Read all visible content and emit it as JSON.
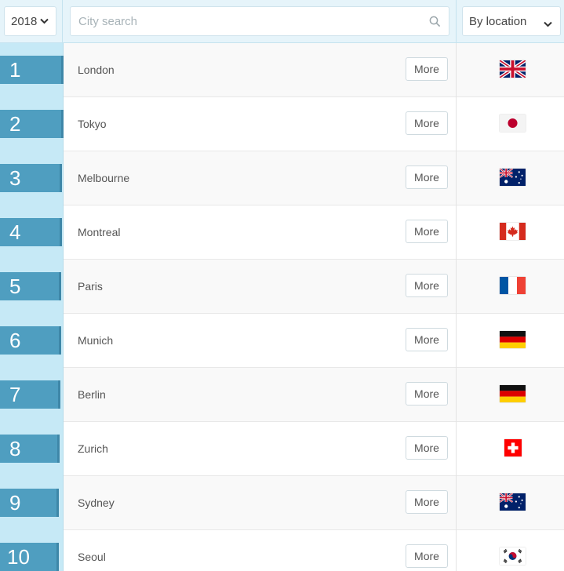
{
  "filters": {
    "year_value": "2018",
    "search_placeholder": "City search",
    "sort_value": "By location"
  },
  "colors": {
    "rank_bar": "#4f9ec0",
    "rank_cell": "#c6e9f6",
    "header_bg": "#e6f4fa"
  },
  "rows": [
    {
      "rank": "1",
      "city": "London",
      "more": "More",
      "flag": "uk-flag-icon"
    },
    {
      "rank": "2",
      "city": "Tokyo",
      "more": "More",
      "flag": "japan-flag-icon"
    },
    {
      "rank": "3",
      "city": "Melbourne",
      "more": "More",
      "flag": "australia-flag-icon"
    },
    {
      "rank": "4",
      "city": "Montreal",
      "more": "More",
      "flag": "canada-flag-icon"
    },
    {
      "rank": "5",
      "city": "Paris",
      "more": "More",
      "flag": "france-flag-icon"
    },
    {
      "rank": "6",
      "city": "Munich",
      "more": "More",
      "flag": "germany-flag-icon"
    },
    {
      "rank": "7",
      "city": "Berlin",
      "more": "More",
      "flag": "germany-flag-icon"
    },
    {
      "rank": "8",
      "city": "Zurich",
      "more": "More",
      "flag": "switzerland-flag-icon"
    },
    {
      "rank": "9",
      "city": "Sydney",
      "more": "More",
      "flag": "australia-flag-icon"
    },
    {
      "rank": "10",
      "city": "Seoul",
      "more": "More",
      "flag": "south-korea-flag-icon"
    }
  ]
}
